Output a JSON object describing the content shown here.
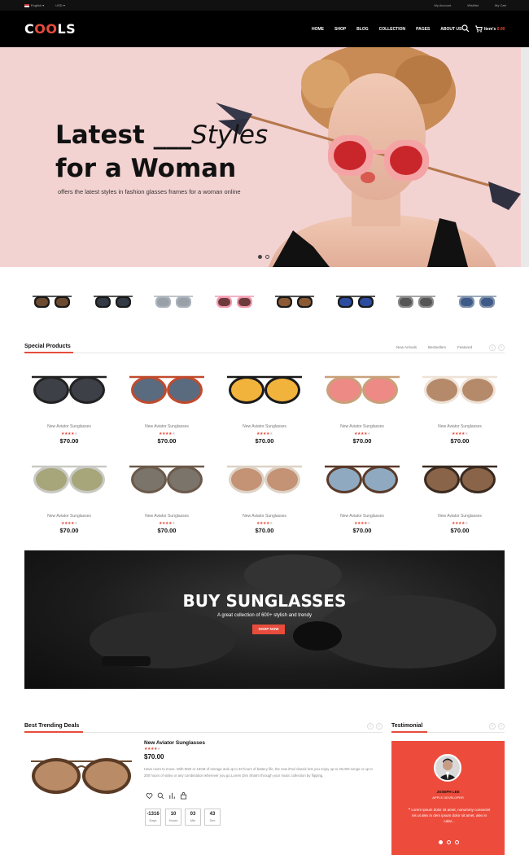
{
  "topbar": {
    "language": "English",
    "currency": "USD",
    "links": [
      "My Account",
      "Wishlist",
      "My Cart"
    ]
  },
  "header": {
    "logo_left": "C",
    "logo_oo": "OO",
    "logo_right": "LS",
    "nav": [
      "HOME",
      "SHOP",
      "BLOG",
      "COLLECTION",
      "PAGES",
      "ABOUT US"
    ],
    "cart_label": "Item's",
    "cart_amount": "0.00",
    "icons": [
      "search-icon",
      "cart-icon"
    ]
  },
  "hero": {
    "line1": "Latest ___",
    "line1_italic": "Styles",
    "line2": "for a Woman",
    "subtitle": "offers the latest styles in fashion glasses frames for a woman online",
    "slide_count": 2,
    "active_slide": 1
  },
  "special": {
    "title": "Special Products",
    "tabs": [
      "New Arrivals",
      "Bestsellers",
      "Featured"
    ],
    "products": [
      {
        "name": "New Aviator Sunglasses",
        "rating": 4,
        "price": "$70.00",
        "lens": "#3d4147",
        "frame": "#222"
      },
      {
        "name": "New Aviator Sunglasses",
        "rating": 4,
        "price": "$70.00",
        "lens": "#5a6a7f",
        "frame": "#c04b2e"
      },
      {
        "name": "New Aviator Sunglasses",
        "rating": 4,
        "price": "$70.00",
        "lens": "#f2b33c",
        "frame": "#1a1a1a"
      },
      {
        "name": "New Aviator Sunglasses",
        "rating": 4,
        "price": "$70.00",
        "lens": "#ee8a86",
        "frame": "#c9a07a"
      },
      {
        "name": "New Aviator Sunglasses",
        "rating": 4,
        "price": "$70.00",
        "lens": "#b48a6a",
        "frame": "#efe2d6"
      },
      {
        "name": "New Aviator Sunglasses",
        "rating": 4,
        "price": "$70.00",
        "lens": "#a7a57a",
        "frame": "#c9c9c4"
      },
      {
        "name": "New Aviator Sunglasses",
        "rating": 4,
        "price": "$70.00",
        "lens": "#7b746b",
        "frame": "#6b5a4a"
      },
      {
        "name": "New Aviator Sunglasses",
        "rating": 4,
        "price": "$70.00",
        "lens": "#c49274",
        "frame": "#ddd2c5"
      },
      {
        "name": "New Aviator Sunglasses",
        "rating": 4,
        "price": "$70.00",
        "lens": "#8ea9c0",
        "frame": "#5a3a2a"
      },
      {
        "name": "New Aviator Sunglasses",
        "rating": 4,
        "price": "$70.00",
        "lens": "#8a6448",
        "frame": "#3a2a20"
      }
    ]
  },
  "banner": {
    "title": "BUY SUNGLASSES",
    "subtitle": "A great collection of 600+ stylish and trendy",
    "button": "SHOP NOW"
  },
  "trending": {
    "title": "Best Trending Deals",
    "product": "New Aviator Sunglasses",
    "rating": 4,
    "price": "$70.00",
    "description": "Have room to move. With 8GB or 16GB of storage and up to 40 hours of battery life, the new iPod classic lets you enjoy up to 40,000 songs or up to 200 hours of video or any combination wherever you go.Lorem Dim Sharm through your music collection by flipping.",
    "countdown": [
      {
        "value": "-1316",
        "unit": "Days"
      },
      {
        "value": "10",
        "unit": "Hours"
      },
      {
        "value": "03",
        "unit": "Min"
      },
      {
        "value": "43",
        "unit": "Sec"
      }
    ],
    "icons": [
      "heart-icon",
      "search-icon",
      "compare-icon",
      "bag-icon"
    ]
  },
  "testimonial": {
    "title": "Testimonial",
    "name": "JOSEPH LEE",
    "role": "APPLE DEVELOPER",
    "quote": "Lorem ipsum dolor sit amet, nonummy consectet nis ut alex in dem ipsum dolor sit amet, alex in calar...",
    "slide_count": 3,
    "active_slide": 0
  },
  "colors": {
    "accent": "#e74c3c",
    "header": "#000000",
    "hero_bg": "#f3d2d2"
  }
}
